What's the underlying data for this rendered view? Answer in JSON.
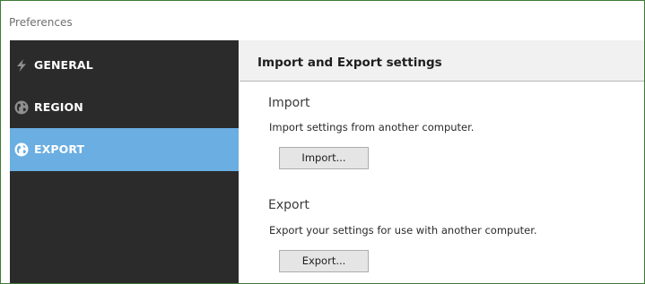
{
  "window": {
    "title": "Preferences"
  },
  "sidebar": {
    "items": [
      {
        "label": "GENERAL",
        "icon": "lightning-icon",
        "active": false
      },
      {
        "label": "REGION",
        "icon": "globe-icon",
        "active": false
      },
      {
        "label": "EXPORT",
        "icon": "globe-icon",
        "active": true
      }
    ]
  },
  "content": {
    "header": "Import and Export settings",
    "import": {
      "title": "Import",
      "description": "Import settings from another computer.",
      "button_label": "Import..."
    },
    "export": {
      "title": "Export",
      "description": "Export your settings for use with another computer.",
      "button_label": "Export..."
    }
  },
  "colors": {
    "sidebar_bg": "#2b2b2b",
    "active_item": "#6aaee2",
    "window_border": "#3c7a34"
  }
}
